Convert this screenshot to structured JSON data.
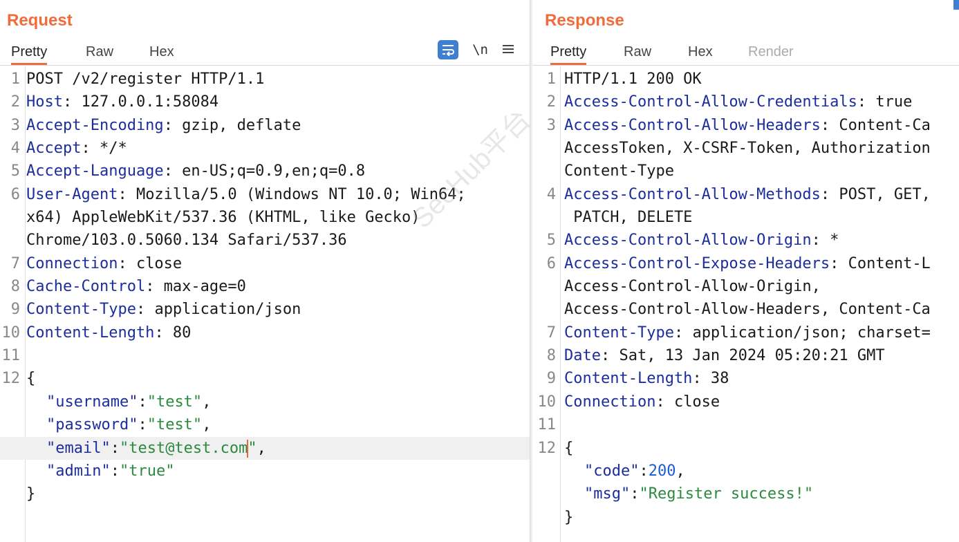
{
  "request": {
    "title": "Request",
    "tabs": [
      "Pretty",
      "Raw",
      "Hex"
    ],
    "icons": [
      "wrap-lines-icon",
      "newline-icon",
      "menu-icon"
    ],
    "newline_label": "\\n",
    "lines": [
      {
        "n": "1",
        "parts": [
          [
            "v",
            "POST /v2/register HTTP/1.1"
          ]
        ]
      },
      {
        "n": "2",
        "parts": [
          [
            "k",
            "Host"
          ],
          [
            "p",
            ": 127.0.0.1:58084"
          ]
        ]
      },
      {
        "n": "3",
        "parts": [
          [
            "k",
            "Accept-Encoding"
          ],
          [
            "p",
            ": gzip, deflate"
          ]
        ]
      },
      {
        "n": "4",
        "parts": [
          [
            "k",
            "Accept"
          ],
          [
            "p",
            ": */*"
          ]
        ]
      },
      {
        "n": "5",
        "parts": [
          [
            "k",
            "Accept-Language"
          ],
          [
            "p",
            ": en-US;q=0.9,en;q=0.8"
          ]
        ]
      },
      {
        "n": "6",
        "parts": [
          [
            "k",
            "User-Agent"
          ],
          [
            "p",
            ": Mozilla/5.0 (Windows NT 10.0; Win64;"
          ]
        ]
      },
      {
        "n": "",
        "parts": [
          [
            "p",
            "x64) AppleWebKit/537.36 (KHTML, like Gecko)"
          ]
        ]
      },
      {
        "n": "",
        "parts": [
          [
            "p",
            "Chrome/103.0.5060.134 Safari/537.36"
          ]
        ]
      },
      {
        "n": "7",
        "parts": [
          [
            "k",
            "Connection"
          ],
          [
            "p",
            ": close"
          ]
        ]
      },
      {
        "n": "8",
        "parts": [
          [
            "k",
            "Cache-Control"
          ],
          [
            "p",
            ": max-age=0"
          ]
        ]
      },
      {
        "n": "9",
        "parts": [
          [
            "k",
            "Content-Type"
          ],
          [
            "p",
            ": application/json"
          ]
        ]
      },
      {
        "n": "10",
        "parts": [
          [
            "k",
            "Content-Length"
          ],
          [
            "p",
            ": 80"
          ]
        ]
      },
      {
        "n": "11",
        "parts": []
      },
      {
        "n": "12",
        "parts": [
          [
            "p",
            "{"
          ]
        ]
      },
      {
        "n": "",
        "indent": true,
        "parts": [
          [
            "jk",
            "\"username\""
          ],
          [
            "p",
            ":"
          ],
          [
            "js",
            "\"test\""
          ],
          [
            "p",
            ","
          ]
        ]
      },
      {
        "n": "",
        "indent": true,
        "parts": [
          [
            "jk",
            "\"password\""
          ],
          [
            "p",
            ":"
          ],
          [
            "js",
            "\"test\""
          ],
          [
            "p",
            ","
          ]
        ]
      },
      {
        "n": "",
        "indent": true,
        "highlight": true,
        "cursor_after": 2,
        "parts": [
          [
            "jk",
            "\"email\""
          ],
          [
            "p",
            ":"
          ],
          [
            "js",
            "\"test@test.com"
          ],
          [
            "js",
            "\""
          ],
          [
            "p",
            ","
          ]
        ]
      },
      {
        "n": "",
        "indent": true,
        "parts": [
          [
            "jk",
            "\"admin\""
          ],
          [
            "p",
            ":"
          ],
          [
            "js",
            "\"true\""
          ]
        ]
      },
      {
        "n": "",
        "parts": [
          [
            "p",
            "}"
          ]
        ]
      }
    ]
  },
  "response": {
    "title": "Response",
    "tabs": [
      "Pretty",
      "Raw",
      "Hex",
      "Render"
    ],
    "lines": [
      {
        "n": "1",
        "parts": [
          [
            "v",
            "HTTP/1.1 200 OK"
          ]
        ]
      },
      {
        "n": "2",
        "parts": [
          [
            "k",
            "Access-Control-Allow-Credentials"
          ],
          [
            "p",
            ": true"
          ]
        ]
      },
      {
        "n": "3",
        "parts": [
          [
            "k",
            "Access-Control-Allow-Headers"
          ],
          [
            "p",
            ": Content-Ca"
          ]
        ]
      },
      {
        "n": "",
        "parts": [
          [
            "p",
            "AccessToken, X-CSRF-Token, Authorization"
          ]
        ]
      },
      {
        "n": "",
        "parts": [
          [
            "p",
            "Content-Type"
          ]
        ]
      },
      {
        "n": "4",
        "parts": [
          [
            "k",
            "Access-Control-Allow-Methods"
          ],
          [
            "p",
            ": POST, GET,"
          ]
        ]
      },
      {
        "n": "",
        "parts": [
          [
            "p",
            " PATCH, DELETE"
          ]
        ]
      },
      {
        "n": "5",
        "parts": [
          [
            "k",
            "Access-Control-Allow-Origin"
          ],
          [
            "p",
            ": *"
          ]
        ]
      },
      {
        "n": "6",
        "parts": [
          [
            "k",
            "Access-Control-Expose-Headers"
          ],
          [
            "p",
            ": Content-L"
          ]
        ]
      },
      {
        "n": "",
        "parts": [
          [
            "p",
            "Access-Control-Allow-Origin,"
          ]
        ]
      },
      {
        "n": "",
        "parts": [
          [
            "p",
            "Access-Control-Allow-Headers, Content-Ca"
          ]
        ]
      },
      {
        "n": "7",
        "parts": [
          [
            "k",
            "Content-Type"
          ],
          [
            "p",
            ": application/json; charset="
          ]
        ]
      },
      {
        "n": "8",
        "parts": [
          [
            "k",
            "Date"
          ],
          [
            "p",
            ": Sat, 13 Jan 2024 05:20:21 GMT"
          ]
        ]
      },
      {
        "n": "9",
        "parts": [
          [
            "k",
            "Content-Length"
          ],
          [
            "p",
            ": 38"
          ]
        ]
      },
      {
        "n": "10",
        "parts": [
          [
            "k",
            "Connection"
          ],
          [
            "p",
            ": close"
          ]
        ]
      },
      {
        "n": "11",
        "parts": []
      },
      {
        "n": "12",
        "parts": [
          [
            "p",
            "{"
          ]
        ]
      },
      {
        "n": "",
        "indent": true,
        "parts": [
          [
            "jk",
            "\"code\""
          ],
          [
            "p",
            ":"
          ],
          [
            "jn",
            "200"
          ],
          [
            "p",
            ","
          ]
        ]
      },
      {
        "n": "",
        "indent": true,
        "parts": [
          [
            "jk",
            "\"msg\""
          ],
          [
            "p",
            ":"
          ],
          [
            "js",
            "\"Register success!\""
          ]
        ]
      },
      {
        "n": "",
        "parts": [
          [
            "p",
            "}"
          ]
        ]
      }
    ]
  },
  "watermark": "SecHub平台",
  "colors": {
    "accent": "#f26b3a",
    "key": "#1c2d9c",
    "string": "#2a8a3e",
    "number": "#1a5bd6",
    "wrap_button": "#3f7fd2"
  }
}
